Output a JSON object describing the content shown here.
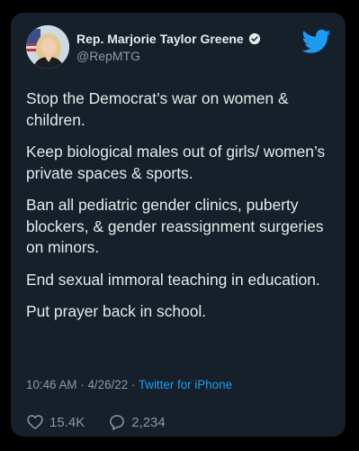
{
  "author": {
    "name": "Rep. Marjorie Taylor Greene",
    "handle": "@RepMTG"
  },
  "tweet": {
    "paragraphs": [
      "Stop the Democrat’s war on women & children.",
      "Keep biological males out of girls/ women’s private spaces & sports.",
      "Ban all pediatric gender clinics, puberty blockers, & gender reassignment surgeries on minors.",
      "End sexual immoral teaching in education.",
      "Put prayer back in school."
    ]
  },
  "meta": {
    "time": "10:46 AM",
    "separator1": " · ",
    "date": "4/26/22",
    "separator2": " · ",
    "source": "Twitter for iPhone"
  },
  "stats": {
    "likes": "15.4K",
    "replies": "2,234"
  },
  "colors": {
    "card_bg": "#15202b",
    "accent": "#1d9bf0",
    "muted": "#8b98a5",
    "text": "#e7e9ea"
  },
  "icons": {
    "logo": "twitter-bird-icon",
    "verified": "verified-badge-icon",
    "like": "heart-icon",
    "reply": "speech-bubble-icon"
  }
}
